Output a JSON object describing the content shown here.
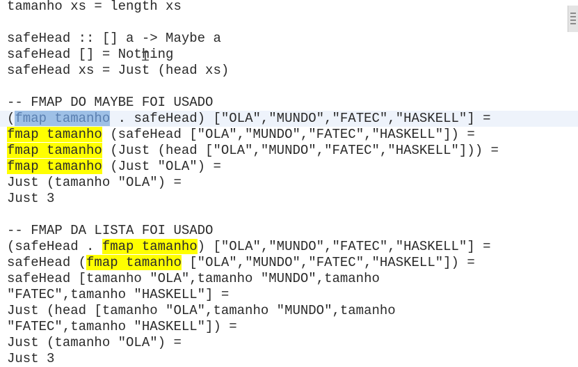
{
  "lines": [
    {
      "segments": [
        {
          "text": "tamanho xs = length xs",
          "hl": ""
        }
      ]
    },
    {
      "segments": [
        {
          "text": "",
          "hl": ""
        }
      ]
    },
    {
      "segments": [
        {
          "text": "safeHead :: [] a -> Maybe a",
          "hl": ""
        }
      ]
    },
    {
      "segments": [
        {
          "text": "safeHead [] = Nothing",
          "hl": ""
        }
      ]
    },
    {
      "segments": [
        {
          "text": "safeHead xs = Just (head xs)",
          "hl": ""
        }
      ]
    },
    {
      "segments": [
        {
          "text": "",
          "hl": ""
        }
      ]
    },
    {
      "segments": [
        {
          "text": "-- FMAP DO MAYBE FOI USADO",
          "hl": ""
        }
      ]
    },
    {
      "current": true,
      "segments": [
        {
          "text": "(",
          "hl": ""
        },
        {
          "text": "fmap tamanho",
          "hl": "sel"
        },
        {
          "text": " . safeHead) [\"OLA\",\"MUNDO\",\"FATEC\",\"HASKELL\"] =",
          "hl": ""
        }
      ]
    },
    {
      "segments": [
        {
          "text": "fmap tamanho",
          "hl": "yellow"
        },
        {
          "text": " (safeHead [\"OLA\",\"MUNDO\",\"FATEC\",\"HASKELL\"]) =",
          "hl": ""
        }
      ]
    },
    {
      "segments": [
        {
          "text": "fmap tamanho",
          "hl": "yellow"
        },
        {
          "text": " (Just (head [\"OLA\",\"MUNDO\",\"FATEC\",\"HASKELL\"])) =",
          "hl": ""
        }
      ]
    },
    {
      "segments": [
        {
          "text": "fmap tamanho",
          "hl": "yellow"
        },
        {
          "text": " (Just \"OLA\") =",
          "hl": ""
        }
      ]
    },
    {
      "segments": [
        {
          "text": "Just (tamanho \"OLA\") =",
          "hl": ""
        }
      ]
    },
    {
      "segments": [
        {
          "text": "Just 3",
          "hl": ""
        }
      ]
    },
    {
      "segments": [
        {
          "text": "",
          "hl": ""
        }
      ]
    },
    {
      "segments": [
        {
          "text": "-- FMAP DA LISTA FOI USADO",
          "hl": ""
        }
      ]
    },
    {
      "segments": [
        {
          "text": "(safeHead . ",
          "hl": ""
        },
        {
          "text": "fmap tamanho",
          "hl": "yellow"
        },
        {
          "text": ") [\"OLA\",\"MUNDO\",\"FATEC\",\"HASKELL\"] =",
          "hl": ""
        }
      ]
    },
    {
      "segments": [
        {
          "text": "safeHead (",
          "hl": ""
        },
        {
          "text": "fmap tamanho",
          "hl": "yellow"
        },
        {
          "text": " [\"OLA\",\"MUNDO\",\"FATEC\",\"HASKELL\"]) =",
          "hl": ""
        }
      ]
    },
    {
      "segments": [
        {
          "text": "safeHead [tamanho \"OLA\",tamanho \"MUNDO\",tamanho",
          "hl": ""
        }
      ]
    },
    {
      "segments": [
        {
          "text": "\"FATEC\",tamanho \"HASKELL\"] =",
          "hl": ""
        }
      ]
    },
    {
      "segments": [
        {
          "text": "Just (head [tamanho \"OLA\",tamanho \"MUNDO\",tamanho",
          "hl": ""
        }
      ]
    },
    {
      "segments": [
        {
          "text": "\"FATEC\",tamanho \"HASKELL\"]) =",
          "hl": ""
        }
      ]
    },
    {
      "segments": [
        {
          "text": "Just (tamanho \"OLA\") =",
          "hl": ""
        }
      ]
    },
    {
      "segments": [
        {
          "text": "Just 3",
          "hl": ""
        }
      ]
    }
  ],
  "cursor_icon": "i-beam-cursor-icon",
  "scroll_widget_icon": "scrollbar-grip-icon",
  "colors": {
    "background": "#ffffff",
    "text": "#2a2a2a",
    "highlight_yellow": "#ffff00",
    "selection": "#9ec0e6"
  }
}
